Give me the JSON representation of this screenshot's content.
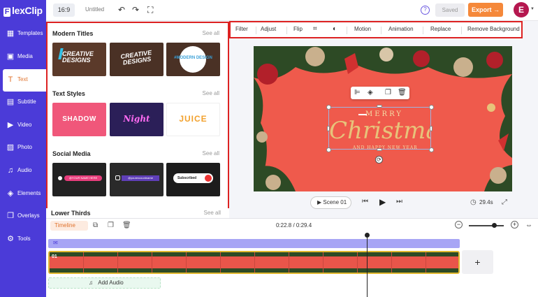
{
  "app": {
    "logo": "lexClip",
    "logo_glyph": "F"
  },
  "nav": {
    "items": [
      {
        "label": "Templates",
        "icon": "templates-icon",
        "glyph": "▦"
      },
      {
        "label": "Media",
        "icon": "media-icon",
        "glyph": "▣"
      },
      {
        "label": "Text",
        "icon": "text-icon",
        "glyph": "T",
        "active": true
      },
      {
        "label": "Subtitle",
        "icon": "subtitle-icon",
        "glyph": "▤"
      },
      {
        "label": "Video",
        "icon": "video-icon",
        "glyph": "▶"
      },
      {
        "label": "Photo",
        "icon": "photo-icon",
        "glyph": "▨"
      },
      {
        "label": "Audio",
        "icon": "audio-icon",
        "glyph": "♫"
      },
      {
        "label": "Elements",
        "icon": "elements-icon",
        "glyph": "◈"
      },
      {
        "label": "Overlays",
        "icon": "overlays-icon",
        "glyph": "❐"
      },
      {
        "label": "Tools",
        "icon": "tools-icon",
        "glyph": "⚙"
      }
    ]
  },
  "topbar": {
    "aspect_ratio": "16:9",
    "project_name": "Untitled",
    "undo_glyph": "↶",
    "redo_glyph": "↷",
    "fullscreen_glyph": "⛶",
    "help_glyph": "?",
    "saved_label": "Saved",
    "export_label": "Export →",
    "avatar_initial": "E",
    "avatar_caret": "▼"
  },
  "panel": {
    "see_all": "See all",
    "sections": [
      {
        "title": "Modern Titles",
        "thumbs": [
          "CREATIVE DESIGNS",
          "CREATIVE DESIGNS",
          "#MODERN DESIGN"
        ]
      },
      {
        "title": "Text Styles",
        "thumbs": [
          "SHADOW",
          "Night",
          "JUICE"
        ]
      },
      {
        "title": "Social Media",
        "thumbs": [
          "@YOUR NAME HERE",
          "@yourexcountname",
          "Subscribed"
        ]
      }
    ],
    "lower_thirds_title": "Lower Thirds"
  },
  "toolbar": {
    "items": [
      "Filter",
      "Adjust",
      "Flip",
      "Motion",
      "Animation",
      "Replace",
      "Remove Background"
    ],
    "crop_glyph": "⌗",
    "color_glyph": "◐"
  },
  "canvas": {
    "text_line1": "MERRY",
    "text_script": "Christmas",
    "text_line3": "AND HAPPY NEW YEAR",
    "float_toolbar": [
      "⊫",
      "◈",
      "❐",
      "🗑"
    ],
    "rotate_glyph": "⟳"
  },
  "playback": {
    "scene_label": "▶ Scene  01",
    "prev_glyph": "⏮",
    "play_glyph": "▶",
    "next_glyph": "⏭",
    "duration": "29.4s",
    "duration_glyph": "◷",
    "fullscreen_glyph": "⤢"
  },
  "timeline": {
    "label": "Timeline",
    "split_glyph": "⧉",
    "duplicate_glyph": "❐",
    "delete_glyph": "🗑",
    "timecode": "0:22.8 / 0:29.4",
    "zoom_minus": "−",
    "zoom_plus": "+",
    "zoom_level": 0.72,
    "fit_glyph": "⇔",
    "text_track_glyph": "✉",
    "clip_number": "01",
    "add_scene": "+",
    "add_audio": "Add Audio",
    "add_audio_glyph": "♫"
  },
  "colors": {
    "nav_bg": "#4b3bd8",
    "accent": "#f5883a",
    "highlight_border": "#dd2222",
    "canvas_bg": "#ef5a4c",
    "gold": "#e7c37a"
  }
}
